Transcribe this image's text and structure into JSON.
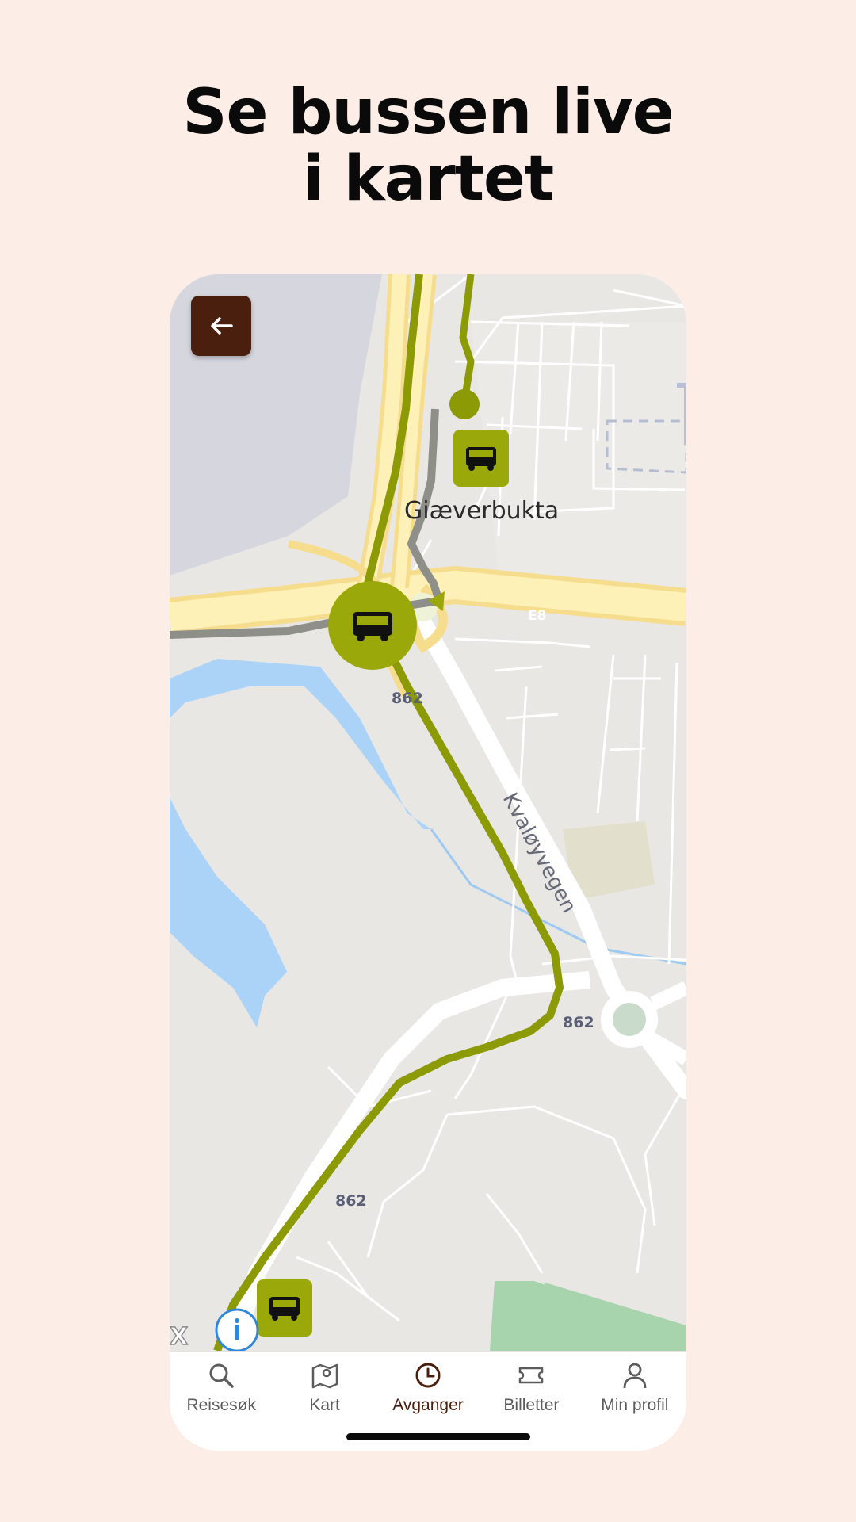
{
  "headline": {
    "line1": "Se bussen live",
    "line2": "i kartet"
  },
  "map": {
    "place_label": "Giæverbukta",
    "road_label": "Kvaløyvegen",
    "highway_label": "E8",
    "route_number_label": "862",
    "route_color": "#9aa80a"
  },
  "back_button": {
    "icon": "arrow-left-icon"
  },
  "tabs": [
    {
      "label": "Reisesøk",
      "icon": "search-icon",
      "active": false
    },
    {
      "label": "Kart",
      "icon": "map-icon",
      "active": false
    },
    {
      "label": "Avganger",
      "icon": "clock-icon",
      "active": true
    },
    {
      "label": "Billetter",
      "icon": "ticket-icon",
      "active": false
    },
    {
      "label": "Min profil",
      "icon": "profile-icon",
      "active": false
    }
  ],
  "colors": {
    "brand": "#4b1f0e",
    "background": "#fcede6"
  }
}
